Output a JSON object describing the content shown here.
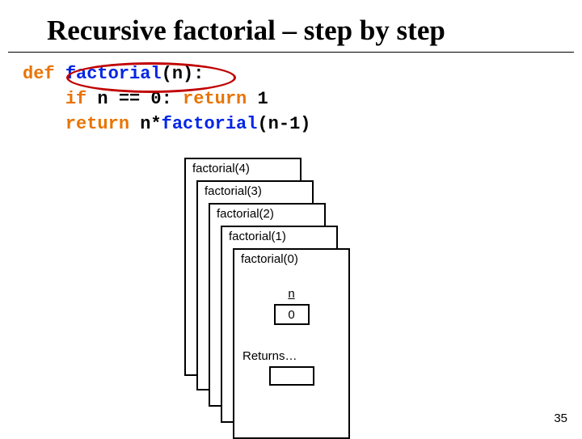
{
  "title": "Recursive factorial – step by step",
  "code": {
    "kw_def": "def",
    "fn_name": "factorial",
    "sig_open": "(n):",
    "kw_if": "if",
    "cond": " n == 0: ",
    "kw_return1": "return",
    "ret1_val": " 1",
    "kw_return2": "return",
    "ret2_expr_pre": " n*",
    "ret2_call_args": "(n-1)"
  },
  "stack": {
    "frames": [
      {
        "label": "factorial(4)"
      },
      {
        "label": "factorial(3)"
      },
      {
        "label": "factorial(2)"
      },
      {
        "label": "factorial(1)"
      },
      {
        "label": "factorial(0)"
      }
    ],
    "var_name": "n",
    "var_value": "0",
    "returns_label": "Returns…",
    "returns_value": ""
  },
  "page_number": "35"
}
